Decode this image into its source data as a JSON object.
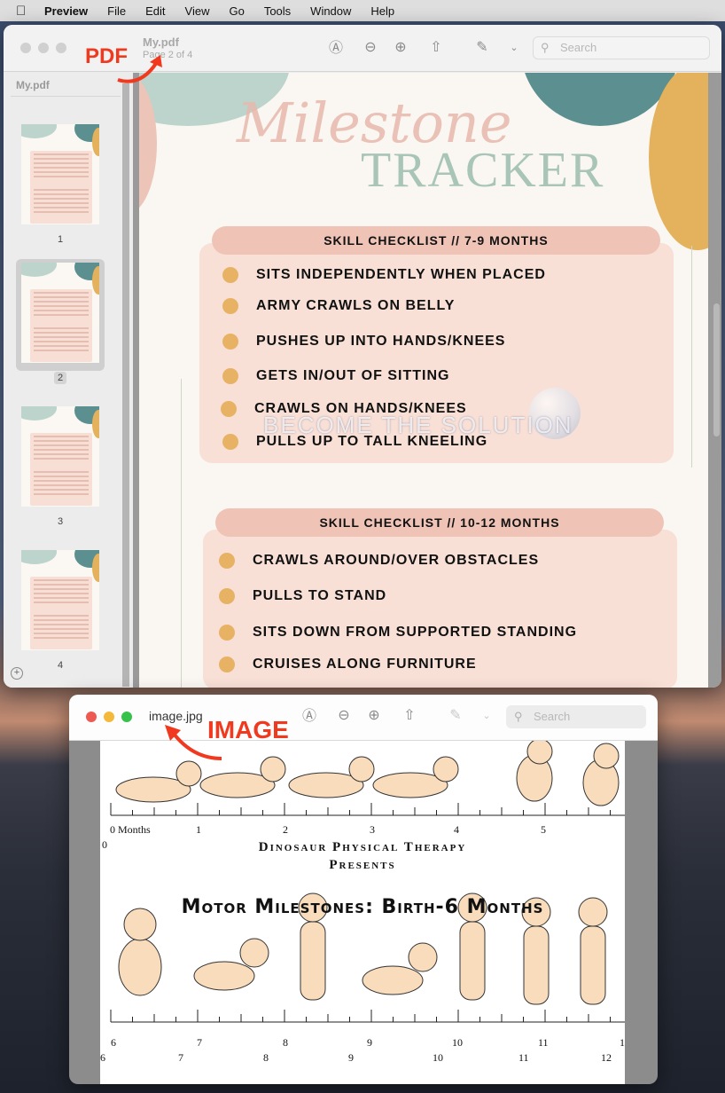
{
  "menubar": {
    "apple": "",
    "items": [
      "Preview",
      "File",
      "Edit",
      "View",
      "Go",
      "Tools",
      "Window",
      "Help"
    ]
  },
  "pdf_window": {
    "title": "My.pdf",
    "subtitle": "Page 2 of 4",
    "search_placeholder": "Search",
    "sidebar": {
      "title": "My.pdf",
      "pages": [
        "1",
        "2",
        "3",
        "4"
      ],
      "selected_page": "2"
    },
    "page": {
      "title_script": "Milestone",
      "title_main": "TRACKER",
      "sections": [
        {
          "heading": "SKILL CHECKLIST // 7-9 MONTHS",
          "items": [
            "SITS INDEPENDENTLY WHEN PLACED",
            "ARMY CRAWLS ON BELLY",
            "PUSHES UP INTO HANDS/KNEES",
            "GETS IN/OUT OF SITTING",
            "CRAWLS ON HANDS/KNEES",
            "PULLS UP TO TALL KNEELING"
          ]
        },
        {
          "heading": "SKILL CHECKLIST // 10-12 MONTHS",
          "items": [
            "CRAWLS AROUND/OVER OBSTACLES",
            "PULLS TO STAND",
            "SITS DOWN FROM SUPPORTED STANDING",
            "CRUISES ALONG FURNITURE"
          ]
        }
      ],
      "watermark": "BECOME THE SOLUTION"
    },
    "annotation": "PDF"
  },
  "image_window": {
    "title": "image.jpg",
    "search_placeholder": "Search",
    "annotation": "IMAGE",
    "image": {
      "top_ruler_labels": [
        "0 Months",
        "1",
        "2",
        "3",
        "4",
        "5"
      ],
      "top_ruler_sub": "0",
      "caption_line1": "Dinosaur Physical Therapy",
      "caption_line2": "Presents",
      "heading": "Motor Milestones: Birth-6 Months",
      "bottom_ruler_labels": [
        "6",
        "7",
        "8",
        "9",
        "10",
        "11",
        "1"
      ],
      "bottom_ruler_sub": [
        "6",
        "7",
        "8",
        "9",
        "10",
        "11",
        "12"
      ]
    }
  },
  "colors": {
    "accent_annotation": "#f0391e",
    "section_header": "#efc4b6",
    "section_bg": "#f8e0d6",
    "bullet": "#e8b264",
    "tracker_green": "#a9c5b8",
    "teal": "#5c9090"
  }
}
